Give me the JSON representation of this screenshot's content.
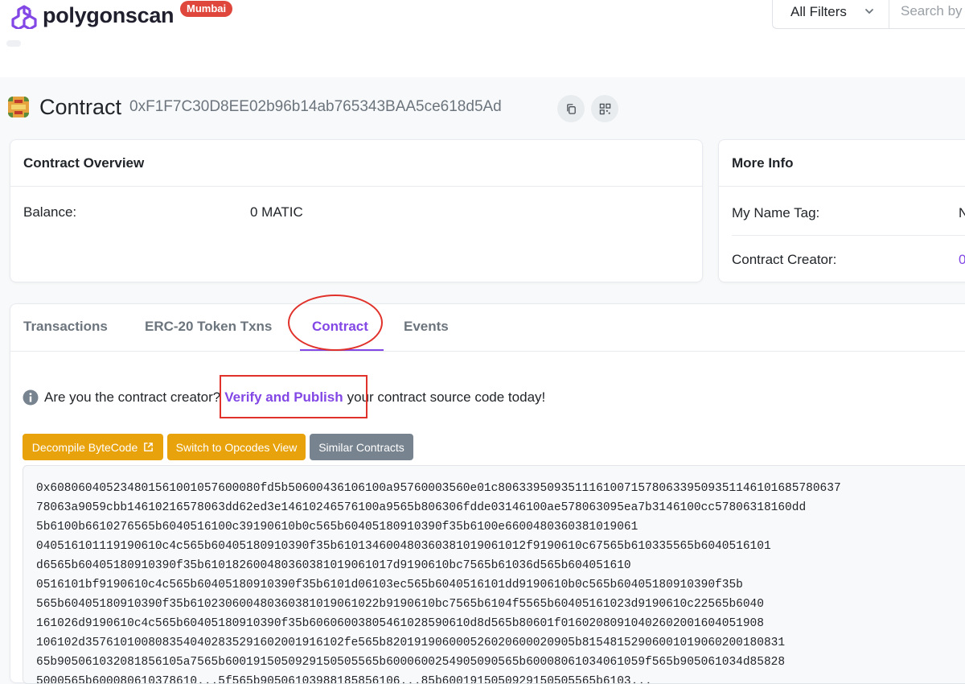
{
  "header": {
    "brand": "polygonscan",
    "network_badge": "Mumbai",
    "filter_label": "All Filters",
    "search_placeholder": "Search by"
  },
  "page": {
    "title": "Contract",
    "address": "0xF1F7C30D8EE02b96b14ab765343BAA5ce618d5Ad"
  },
  "overview": {
    "header": "Contract Overview",
    "balance_label": "Balance:",
    "balance_value": "0 MATIC"
  },
  "more_info": {
    "header": "More Info",
    "name_tag_label": "My Name Tag:",
    "name_tag_value": "N",
    "creator_label": "Contract Creator:",
    "creator_value": "0"
  },
  "tabs": [
    {
      "label": "Transactions"
    },
    {
      "label": "ERC-20 Token Txns"
    },
    {
      "label": "Contract"
    },
    {
      "label": "Events"
    }
  ],
  "notice": {
    "prefix": "Are you the contract creator?",
    "link": "Verify and Publish",
    "suffix": "your contract source code today!"
  },
  "buttons": {
    "decompile": "Decompile ByteCode",
    "opcodes": "Switch to Opcodes View",
    "similar": "Similar Contracts"
  },
  "bytecode_lines": [
    "0x608060405234801561001057600080fd5b50600436106100a95760003560e01c8063395093511161007157806339509351146101685780637",
    "78063a9059cbb14610216578063dd62ed3e14610246576100a9565b806306fdde03146100ae578063095ea7b3146100cc57806318160dd",
    "5b6100b6610276565b6040516100c39190610b0c565b60405180910390f35b6100e6600480360381019061",
    "040516101119190610c4c565b60405180910390f35b610134600480360381019061012f9190610c67565b610335565b6040516101",
    "d6565b60405180910390f35b610182600480360381019061017d9190610bc7565b61036d565b604051610",
    "0516101bf9190610c4c565b60405180910390f35b6101d06103ec565b6040516101dd9190610b0c565b60405180910390f35b",
    "565b60405180910390f35b610230600480360381019061022b9190610bc7565b6104f5565b60405161023d9190610c22565b6040",
    "161026d9190610c4c565b60405180910390f35b60606003805461028590610d8d565b80601f01602080910402602001604051908",
    "106102d3576101008083540402835291602001916102fe565b820191906000526020600020905b81548152906001019060200180831",
    "65b905061032081856105a7565b6001915050929150505565b6000600254905090565b60008061034061059f565b905061034d85828",
    "5000565b600080610378610...5f565b90506103988185856106...85b6001915050929150505565b6103..."
  ]
}
